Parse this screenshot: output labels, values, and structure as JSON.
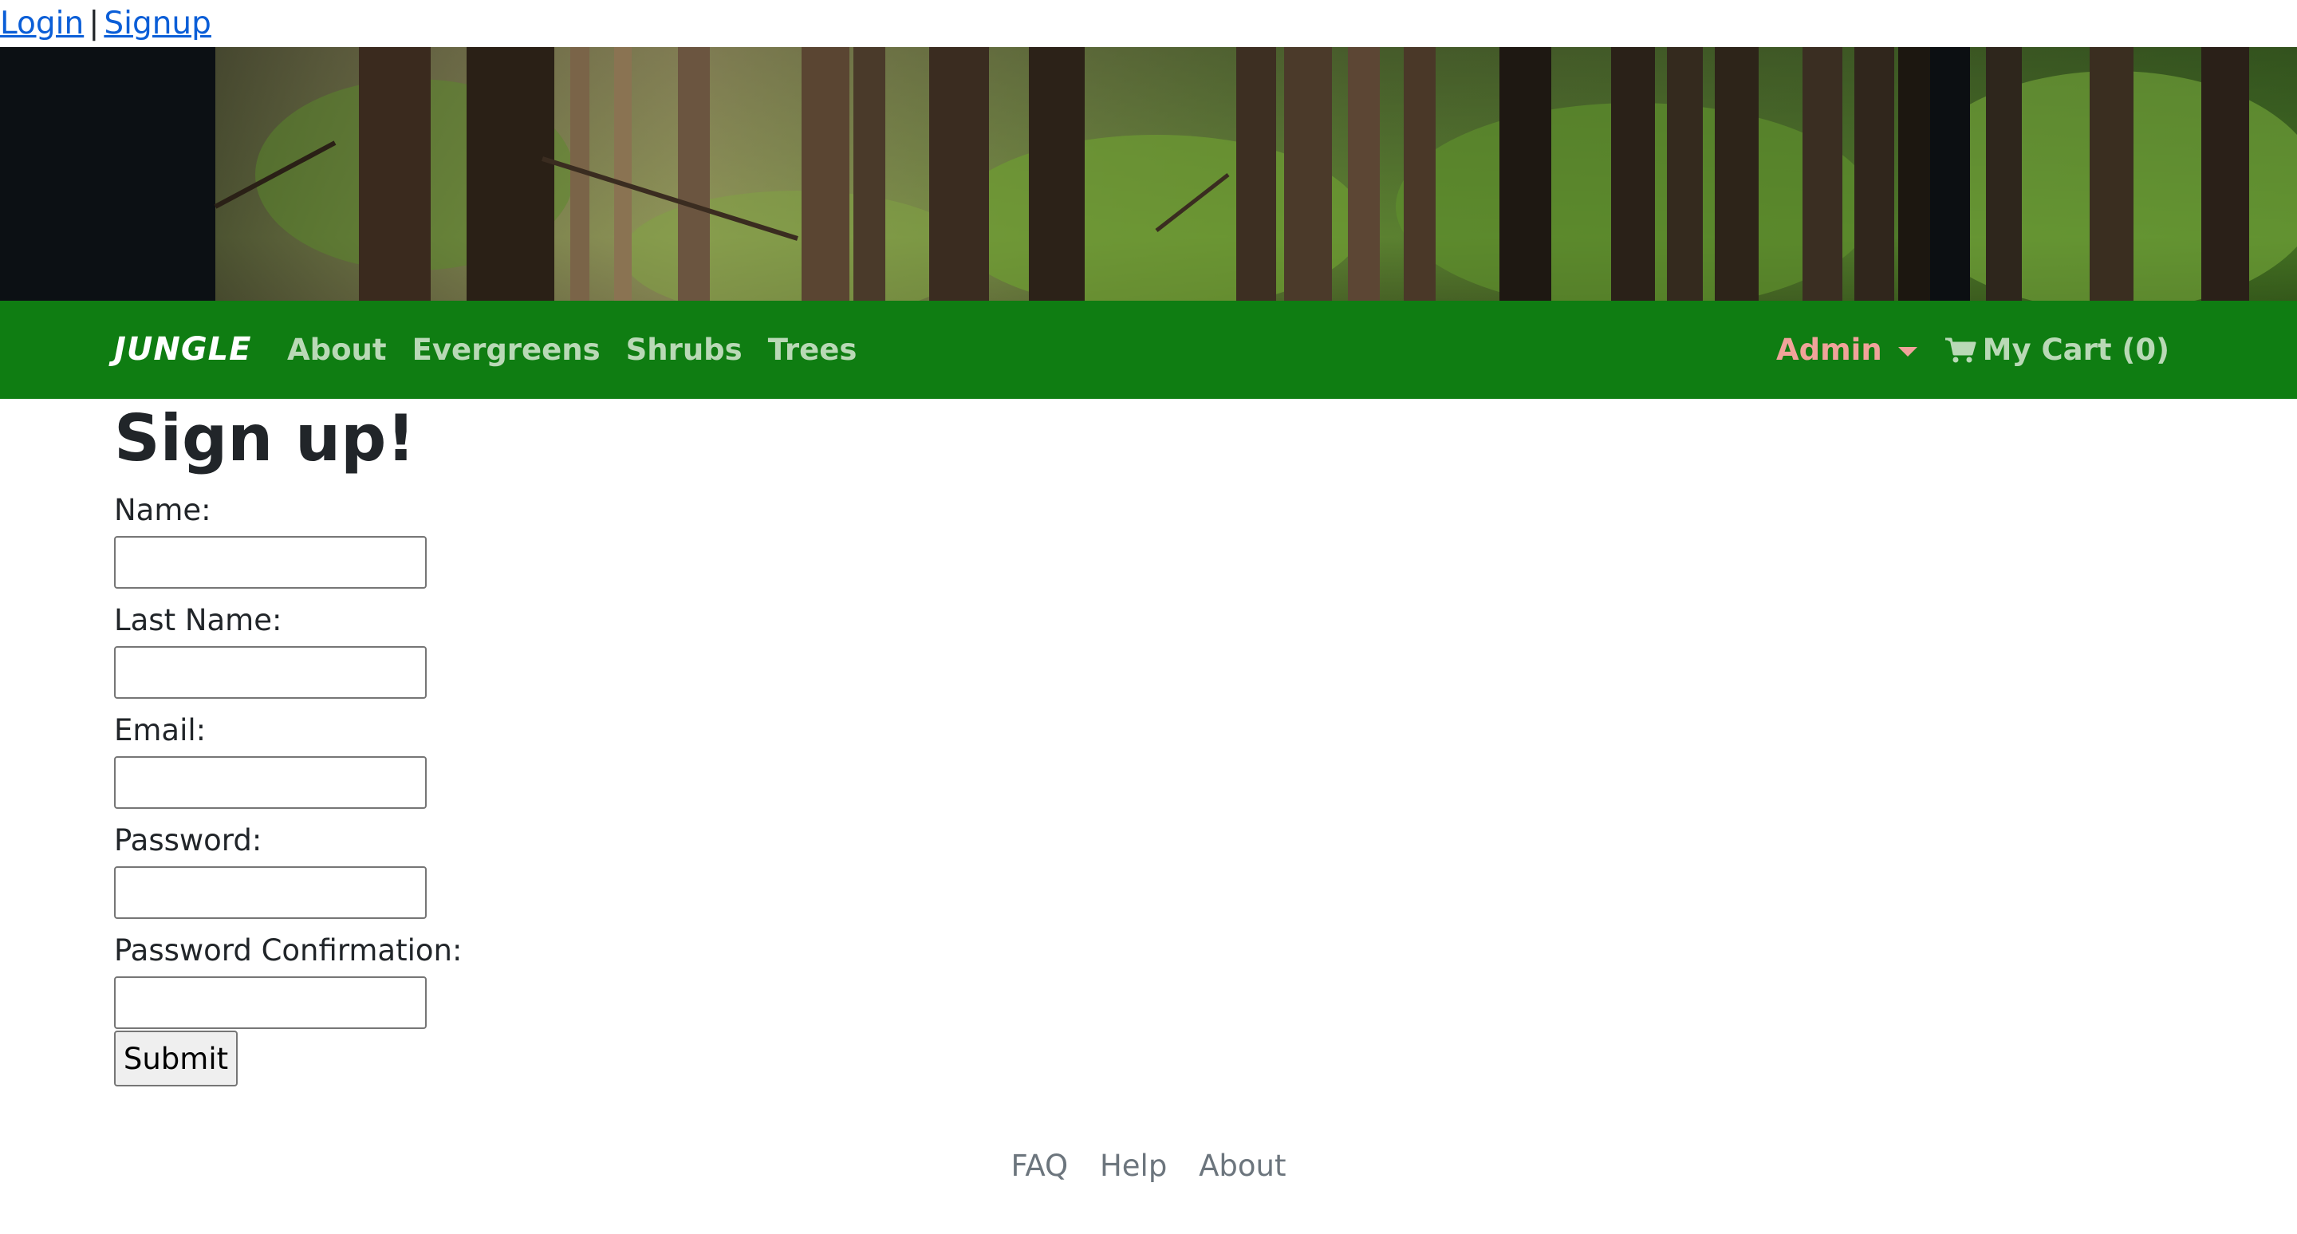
{
  "auth": {
    "login": "Login",
    "separator": "|",
    "signup": "Signup"
  },
  "navbar": {
    "brand": "JUNGLE",
    "links": [
      "About",
      "Evergreens",
      "Shrubs",
      "Trees"
    ],
    "admin": "Admin",
    "cart": "My Cart (0)",
    "colors": {
      "bar": "#0f7d12",
      "link": "#b9d9b6",
      "admin": "#f0a39a"
    }
  },
  "form": {
    "title": "Sign up!",
    "fields": {
      "name": "Name:",
      "last_name": "Last Name:",
      "email": "Email:",
      "password": "Password:",
      "password_confirmation": "Password Confirmation:"
    },
    "submit": "Submit"
  },
  "footer": {
    "links": [
      "FAQ",
      "Help",
      "About"
    ]
  }
}
